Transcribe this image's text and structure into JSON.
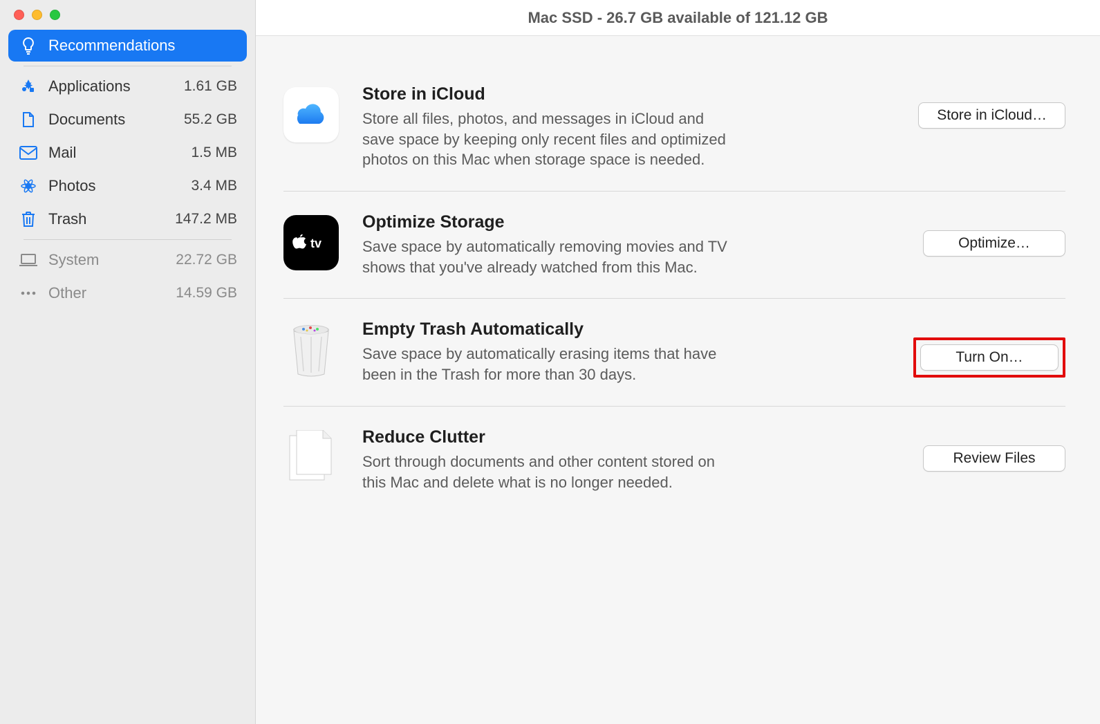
{
  "title": "Mac SSD - 26.7 GB available of 121.12 GB",
  "sidebar": {
    "items": [
      {
        "label": "Recommendations",
        "size": ""
      },
      {
        "label": "Applications",
        "size": "1.61 GB"
      },
      {
        "label": "Documents",
        "size": "55.2 GB"
      },
      {
        "label": "Mail",
        "size": "1.5 MB"
      },
      {
        "label": "Photos",
        "size": "3.4 MB"
      },
      {
        "label": "Trash",
        "size": "147.2 MB"
      },
      {
        "label": "System",
        "size": "22.72 GB"
      },
      {
        "label": "Other",
        "size": "14.59 GB"
      }
    ]
  },
  "recs": {
    "icloud": {
      "title": "Store in iCloud",
      "desc": "Store all files, photos, and messages in iCloud and save space by keeping only recent files and optimized photos on this Mac when storage space is needed.",
      "button": "Store in iCloud…"
    },
    "optimize": {
      "title": "Optimize Storage",
      "desc": "Save space by automatically removing movies and TV shows that you've already watched from this Mac.",
      "button": "Optimize…"
    },
    "trash": {
      "title": "Empty Trash Automatically",
      "desc": "Save space by automatically erasing items that have been in the Trash for more than 30 days.",
      "button": "Turn On…"
    },
    "clutter": {
      "title": "Reduce Clutter",
      "desc": "Sort through documents and other content stored on this Mac and delete what is no longer needed.",
      "button": "Review Files"
    }
  }
}
